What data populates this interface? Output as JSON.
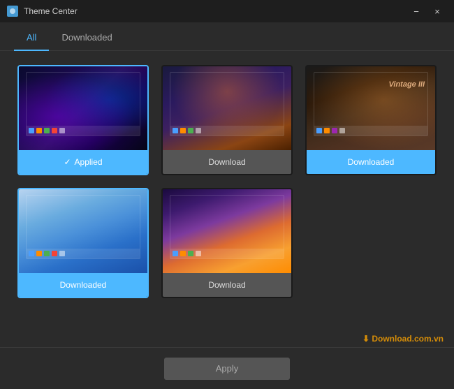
{
  "app": {
    "title": "Theme Center",
    "icon": "🎨"
  },
  "titlebar": {
    "minimize": "−",
    "close": "×"
  },
  "tabs": [
    {
      "id": "all",
      "label": "All",
      "active": true
    },
    {
      "id": "downloaded",
      "label": "Downloaded",
      "active": false
    }
  ],
  "themes": [
    {
      "id": "galaxy",
      "preview_type": "galaxy",
      "label": "Applied",
      "label_type": "applied",
      "selected": true,
      "check": "✓"
    },
    {
      "id": "meteor",
      "preview_type": "meteor",
      "label": "Download",
      "label_type": "download",
      "selected": false
    },
    {
      "id": "warrior",
      "preview_type": "warrior",
      "label": "Downloaded",
      "label_type": "downloaded",
      "selected": false,
      "overlay_text": "Vintage III"
    },
    {
      "id": "butterfly",
      "preview_type": "butterfly",
      "label": "Downloaded",
      "label_type": "downloaded",
      "selected": true
    },
    {
      "id": "sunset",
      "preview_type": "sunset",
      "label": "Download",
      "label_type": "download",
      "selected": false
    }
  ],
  "buttons": {
    "apply": "Apply"
  },
  "watermark": "Download.com.vn"
}
